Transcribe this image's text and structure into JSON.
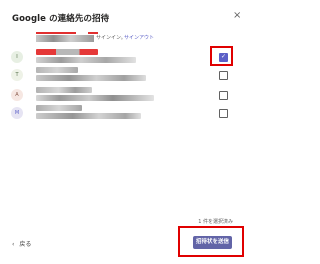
{
  "dialog": {
    "title": "Google の連絡先の招待",
    "close_glyph": "×"
  },
  "account": {
    "signed_in_text": "サインイン。",
    "sign_out_label": "サインアウト"
  },
  "contacts": [
    {
      "avatar_letter": "I",
      "avatar_color": "#e7efe3",
      "checked": true
    },
    {
      "avatar_letter": "T",
      "avatar_color": "#eef2e7",
      "checked": false
    },
    {
      "avatar_letter": "A",
      "avatar_color": "#f6e7e2",
      "checked": false
    },
    {
      "avatar_letter": "M",
      "avatar_color": "#e6e4f3",
      "checked": false
    }
  ],
  "footer": {
    "selected_count": "1 件を選択済み",
    "back_glyph": "‹",
    "back_label": "戻る",
    "send_label": "招待状を送信"
  },
  "colors": {
    "accent": "#6264a7",
    "highlight": "#e00000"
  }
}
